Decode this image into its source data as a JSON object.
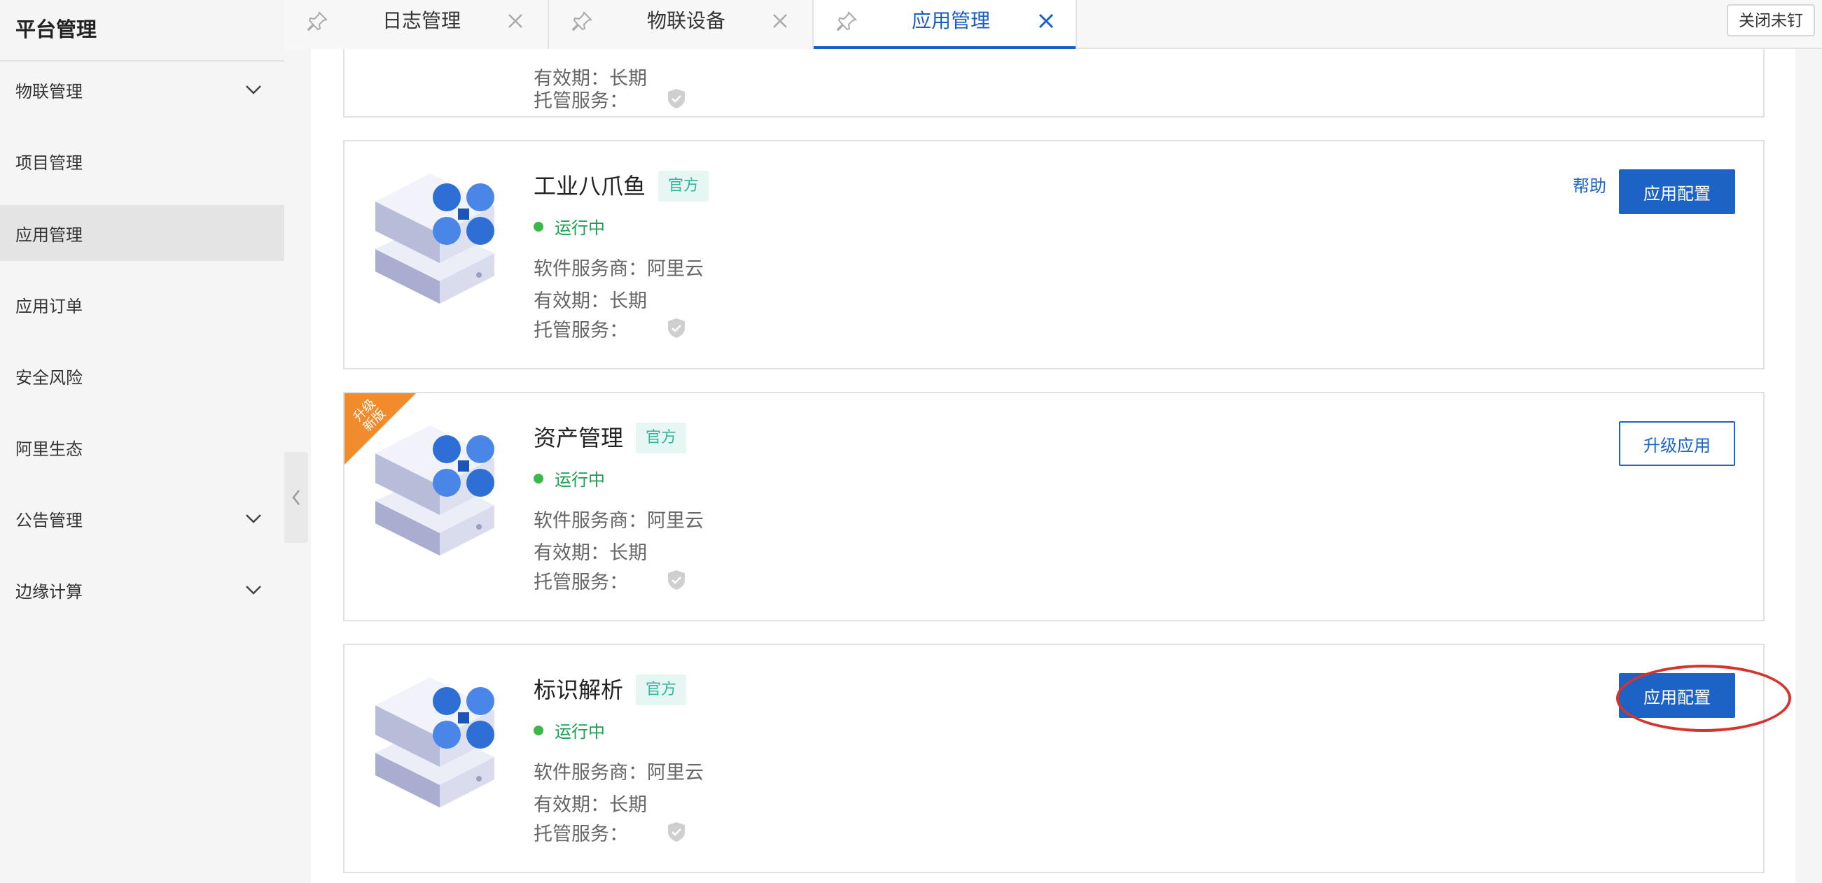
{
  "sidebar": {
    "title": "平台管理",
    "items": [
      {
        "label": "物联管理",
        "has_chevron": true
      },
      {
        "label": "项目管理",
        "has_chevron": false
      },
      {
        "label": "应用管理",
        "has_chevron": false,
        "active": true
      },
      {
        "label": "应用订单",
        "has_chevron": false
      },
      {
        "label": "安全风险",
        "has_chevron": false
      },
      {
        "label": "阿里生态",
        "has_chevron": false
      },
      {
        "label": "公告管理",
        "has_chevron": true
      },
      {
        "label": "边缘计算",
        "has_chevron": true
      }
    ]
  },
  "tabs": [
    {
      "label": "日志管理",
      "active": false
    },
    {
      "label": "物联设备",
      "active": false
    },
    {
      "label": "应用管理",
      "active": true
    }
  ],
  "toolbar": {
    "close_unpinned_label": "关闭未钉"
  },
  "partial_card": {
    "validity": "有效期：长期",
    "hosting": "托管服务："
  },
  "cards": [
    {
      "name": "工业八爪鱼",
      "badge": "官方",
      "status": "运行中",
      "vendor": "软件服务商：阿里云",
      "validity": "有效期：长期",
      "hosting": "托管服务：",
      "help_label": "帮助",
      "action_label": "应用配置"
    },
    {
      "name": "资产管理",
      "badge": "官方",
      "status": "运行中",
      "vendor": "软件服务商：阿里云",
      "validity": "有效期：长期",
      "hosting": "托管服务：",
      "ribbon": "升级\n新版",
      "action_label": "升级应用"
    },
    {
      "name": "标识解析",
      "badge": "官方",
      "status": "运行中",
      "vendor": "软件服务商：阿里云",
      "validity": "有效期：长期",
      "hosting": "托管服务：",
      "action_label": "应用配置"
    }
  ],
  "colors": {
    "primary": "#1d63c6",
    "status_green": "#3cb84a",
    "badge_bg": "#e6f6f2",
    "badge_text": "#33b49a",
    "ribbon": "#f08c2c",
    "highlight": "#d6332c"
  }
}
